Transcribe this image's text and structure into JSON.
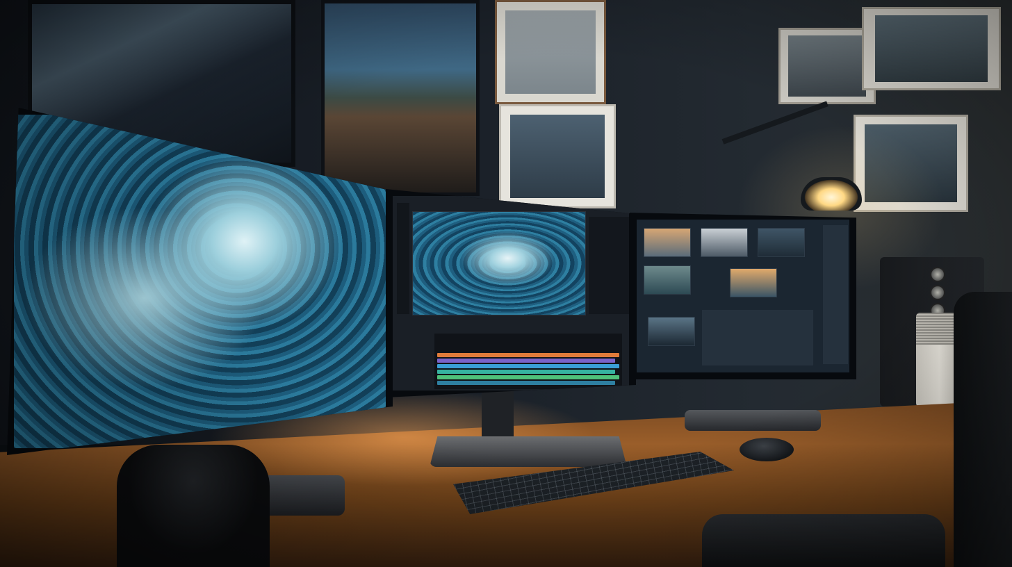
{
  "scene": {
    "subject": "triple-monitor-desk-setup",
    "colors": {
      "wave_blue": "#2b7a9c",
      "desk_wood": "#9a5e2a",
      "lamp_light": "#ffd884",
      "bias_light": "#ffaa5a"
    }
  },
  "monitors": [
    {
      "id": "left",
      "content": "wave-image"
    },
    {
      "id": "center",
      "content": "video-editor"
    },
    {
      "id": "right",
      "content": "media-browser"
    }
  ],
  "timeline_tracks": [
    {
      "color": "#e07b3a"
    },
    {
      "color": "#7a63c9"
    },
    {
      "color": "#3a9fd6"
    },
    {
      "color": "#36b3a0"
    },
    {
      "color": "#4fc17a"
    },
    {
      "color": "#2e7fa1"
    }
  ],
  "icons": [
    "lamp-icon",
    "speaker-icon",
    "keyboard-icon",
    "mouse-icon",
    "camera-icon"
  ]
}
